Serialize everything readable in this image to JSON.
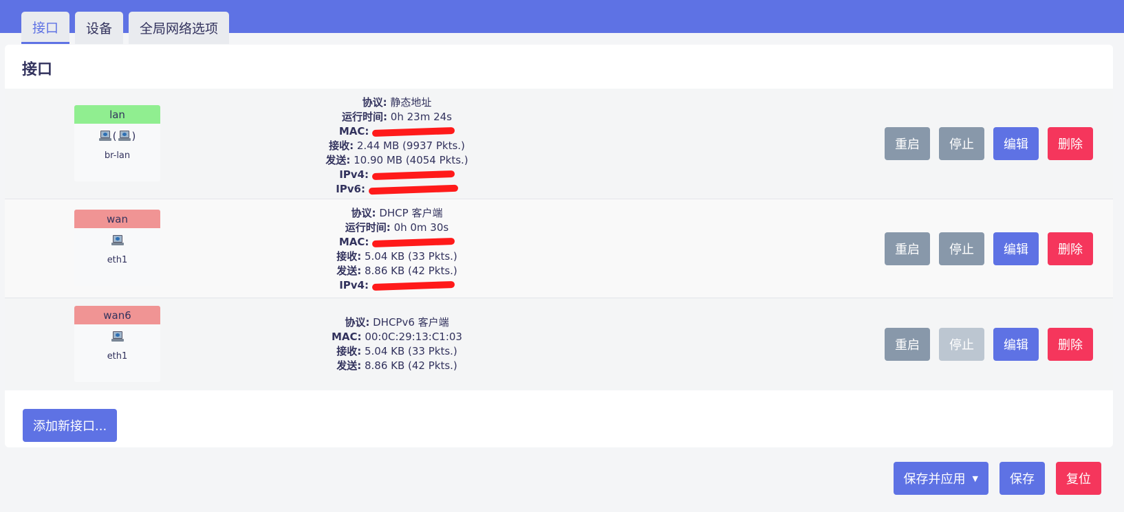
{
  "tabs": [
    {
      "label": "接口",
      "active": true
    },
    {
      "label": "设备",
      "active": false
    },
    {
      "label": "全局网络选项",
      "active": false
    }
  ],
  "section_title": "接口",
  "interfaces": [
    {
      "name": "lan",
      "status": "up",
      "device": "br-lan",
      "info": [
        {
          "k": "协议:",
          "v": "静态地址"
        },
        {
          "k": "运行时间:",
          "v": "0h 23m 24s"
        },
        {
          "k": "MAC:",
          "v": "",
          "redacted": true
        },
        {
          "k": "接收:",
          "v": "2.44 MB (9937 Pkts.)"
        },
        {
          "k": "发送:",
          "v": "10.90 MB (4054 Pkts.)"
        },
        {
          "k": "IPv4:",
          "v": "",
          "redacted": true
        },
        {
          "k": "IPv6:",
          "v": "",
          "redacted": true
        }
      ],
      "stop_disabled": false
    },
    {
      "name": "wan",
      "status": "down",
      "device": "eth1",
      "info": [
        {
          "k": "协议:",
          "v": "DHCP 客户端"
        },
        {
          "k": "运行时间:",
          "v": "0h 0m 30s"
        },
        {
          "k": "MAC:",
          "v": "",
          "redacted": true
        },
        {
          "k": "接收:",
          "v": "5.04 KB (33 Pkts.)"
        },
        {
          "k": "发送:",
          "v": "8.86 KB (42 Pkts.)"
        },
        {
          "k": "IPv4:",
          "v": "",
          "redacted": true
        }
      ],
      "stop_disabled": false
    },
    {
      "name": "wan6",
      "status": "down",
      "device": "eth1",
      "info": [
        {
          "k": "协议:",
          "v": "DHCPv6 客户端"
        },
        {
          "k": "MAC:",
          "v": "00:0C:29:13:C1:03"
        },
        {
          "k": "接收:",
          "v": "5.04 KB (33 Pkts.)"
        },
        {
          "k": "发送:",
          "v": "8.86 KB (42 Pkts.)"
        }
      ],
      "stop_disabled": true
    }
  ],
  "row_buttons": {
    "restart": "重启",
    "stop": "停止",
    "edit": "编辑",
    "delete": "删除"
  },
  "add_button": "添加新接口...",
  "footer": {
    "save_apply": "保存并应用",
    "save": "保存",
    "reset": "复位"
  },
  "colors": {
    "accent": "#5e72e4",
    "danger": "#f5365c",
    "up": "#90ee90",
    "down": "#f09494"
  }
}
